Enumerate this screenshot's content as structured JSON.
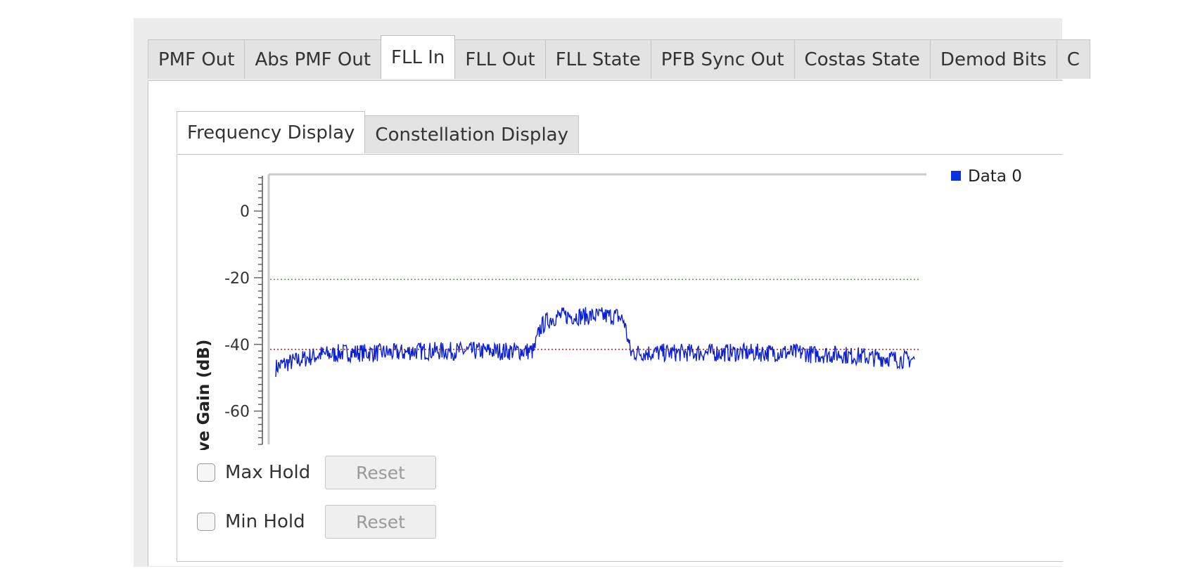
{
  "tabs": [
    "PMF Out",
    "Abs PMF Out",
    "FLL In",
    "FLL Out",
    "FLL State",
    "PFB Sync Out",
    "Costas State",
    "Demod Bits",
    "C"
  ],
  "active_tab": "FLL In",
  "subtabs": [
    "Frequency Display",
    "Constellation Display"
  ],
  "active_subtab": "Frequency Display",
  "controls": {
    "max_hold_label": "Max Hold",
    "min_hold_label": "Min Hold",
    "reset_label": "Reset",
    "max_hold_checked": false,
    "min_hold_checked": false
  },
  "chart_data": {
    "type": "line",
    "ylabel": "ative Gain (dB)",
    "yticks": [
      0,
      -20,
      -40,
      -60
    ],
    "ylim": [
      -70,
      11
    ],
    "legend": "Data 0",
    "legend_position": "top-right",
    "colors": {
      "series": "#0a1fd6",
      "upper_marker": "#39b81f",
      "lower_marker": "#b22222",
      "legend": "#0a32e0"
    },
    "upper_marker_db": -20.5,
    "lower_marker_db": -41.5,
    "series": [
      {
        "name": "Data 0",
        "note_segments": "baseline shape of spectrum across visible frequency span",
        "values": [
          -47,
          -46,
          -45.5,
          -45,
          -44.5,
          -44,
          -43.5,
          -43,
          -43,
          -43,
          -42.5,
          -42.5,
          -42.5,
          -42.5,
          -42.5,
          -42.5,
          -42.5,
          -42.5,
          -42.5,
          -42.5,
          -42.5,
          -42,
          -42,
          -42,
          -42,
          -42,
          -42,
          -42,
          -42,
          -42,
          -42,
          -42,
          -42,
          -42,
          -42,
          -42,
          -42,
          -42,
          -42,
          -42,
          -42,
          -35,
          -33,
          -32,
          -31.5,
          -31.5,
          -31.5,
          -31.5,
          -31.5,
          -31.5,
          -31.5,
          -31.5,
          -31.5,
          -31.5,
          -33,
          -42.5,
          -42.5,
          -42.5,
          -42.5,
          -42.5,
          -42.5,
          -42.5,
          -42.5,
          -42.5,
          -42.5,
          -42.5,
          -42.5,
          -42.5,
          -42.5,
          -42.5,
          -42.5,
          -42.5,
          -42.5,
          -42.5,
          -42.5,
          -42.5,
          -42.5,
          -42.5,
          -42.5,
          -42.5,
          -42.5,
          -42.5,
          -42.5,
          -43,
          -43,
          -43,
          -43,
          -43,
          -43,
          -43.5,
          -43.5,
          -43.5,
          -44,
          -44,
          -44,
          -44,
          -44.5,
          -44.5,
          -44.5,
          -44.5
        ]
      }
    ]
  }
}
